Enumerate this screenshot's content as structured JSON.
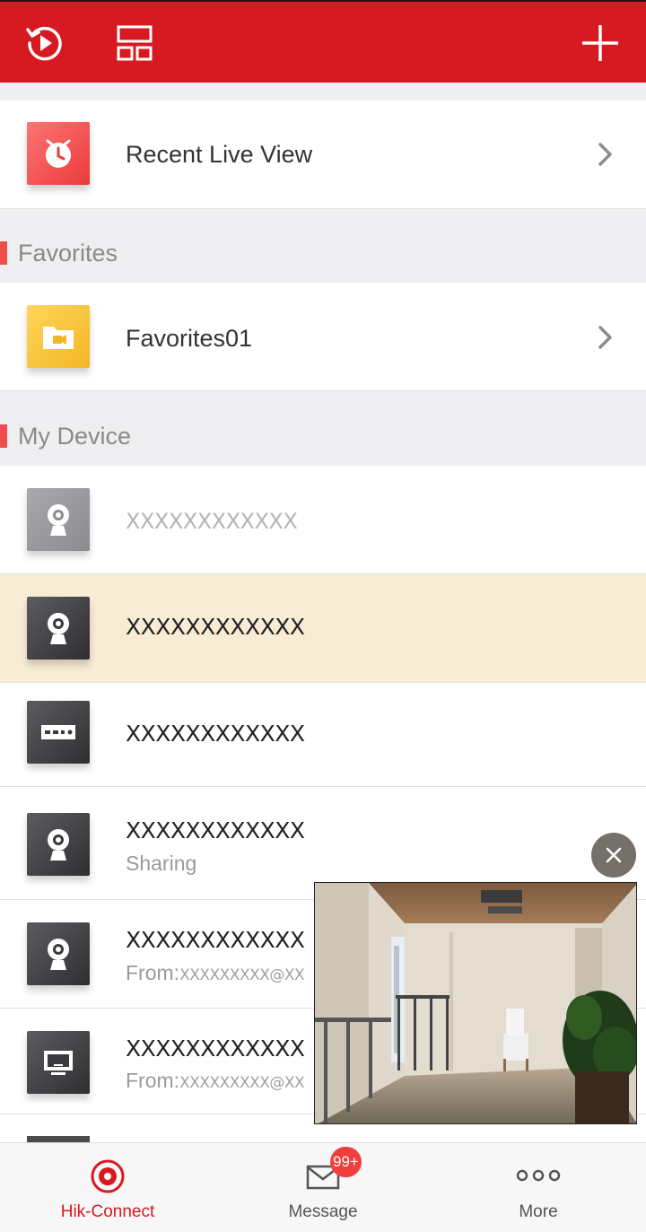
{
  "toolbar": {
    "playback_icon": "playback-icon",
    "layout_icon": "layout-grid-icon",
    "add_icon": "plus-icon"
  },
  "recent": {
    "label": "Recent Live View",
    "icon": "clock-icon"
  },
  "sections": {
    "favorites": "Favorites",
    "my_device": "My Device"
  },
  "favorites": [
    {
      "label": "Favorites01",
      "icon": "folder-video-icon"
    }
  ],
  "devices": [
    {
      "name": "XXXXXXXXXXXX",
      "subtitle": "",
      "icon": "camera-icon",
      "offline": true,
      "selected": false
    },
    {
      "name": "XXXXXXXXXXXX",
      "subtitle": "",
      "icon": "camera-icon",
      "offline": false,
      "selected": true
    },
    {
      "name": "XXXXXXXXXXXX",
      "subtitle": "",
      "icon": "nvr-icon",
      "offline": false,
      "selected": false
    },
    {
      "name": "XXXXXXXXXXXX",
      "subtitle": "Sharing",
      "icon": "camera-icon",
      "offline": false,
      "selected": false
    },
    {
      "name": "XXXXXXXXXXXX",
      "subtitle_prefix": "From:",
      "subtitle_value": "XXXXXXXXX@XX",
      "icon": "camera-icon",
      "offline": false,
      "selected": false
    },
    {
      "name": "XXXXXXXXXXXX",
      "subtitle_prefix": "From:",
      "subtitle_value": "XXXXXXXXX@XX",
      "icon": "monitor-icon",
      "offline": false,
      "selected": false
    }
  ],
  "nav": [
    {
      "label": "Hik-Connect",
      "icon": "hik-connect-icon",
      "active": true
    },
    {
      "label": "Message",
      "icon": "envelope-icon",
      "badge": "99+"
    },
    {
      "label": "More",
      "icon": "more-dots-icon"
    }
  ],
  "colors": {
    "accent": "#d71921",
    "selected_row": "#f8ecd5",
    "section_bar": "#ef4d4d"
  }
}
